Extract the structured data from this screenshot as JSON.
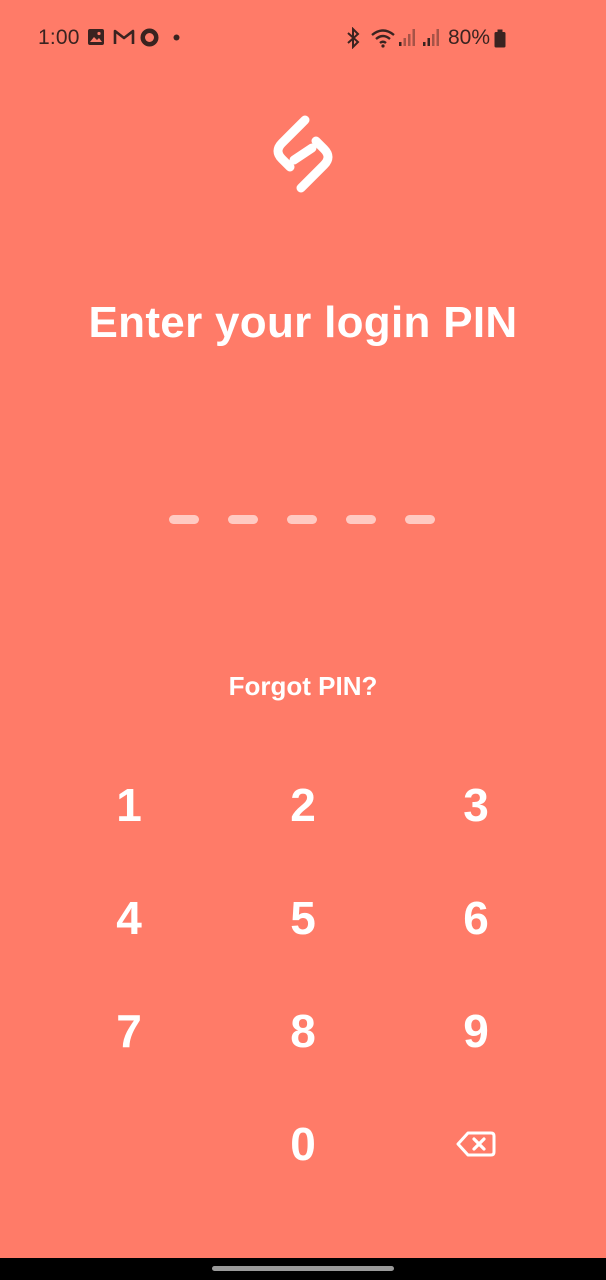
{
  "status_bar": {
    "time": "1:00",
    "battery": "80%",
    "icons": [
      "gallery-icon",
      "gmail-icon",
      "circle-app-icon",
      "dot-icon",
      "bluetooth-icon",
      "wifi-icon",
      "signal-icon",
      "signal-icon",
      "battery-icon"
    ]
  },
  "login": {
    "title": "Enter your login PIN",
    "forgot_label": "Forgot PIN?",
    "pin_length": 5,
    "pin_entered": 0
  },
  "keypad": {
    "keys": [
      "1",
      "2",
      "3",
      "4",
      "5",
      "6",
      "7",
      "8",
      "9",
      "0"
    ],
    "backspace_icon": "backspace-icon"
  },
  "colors": {
    "background": "#ff7b68",
    "text": "#ffffff"
  }
}
